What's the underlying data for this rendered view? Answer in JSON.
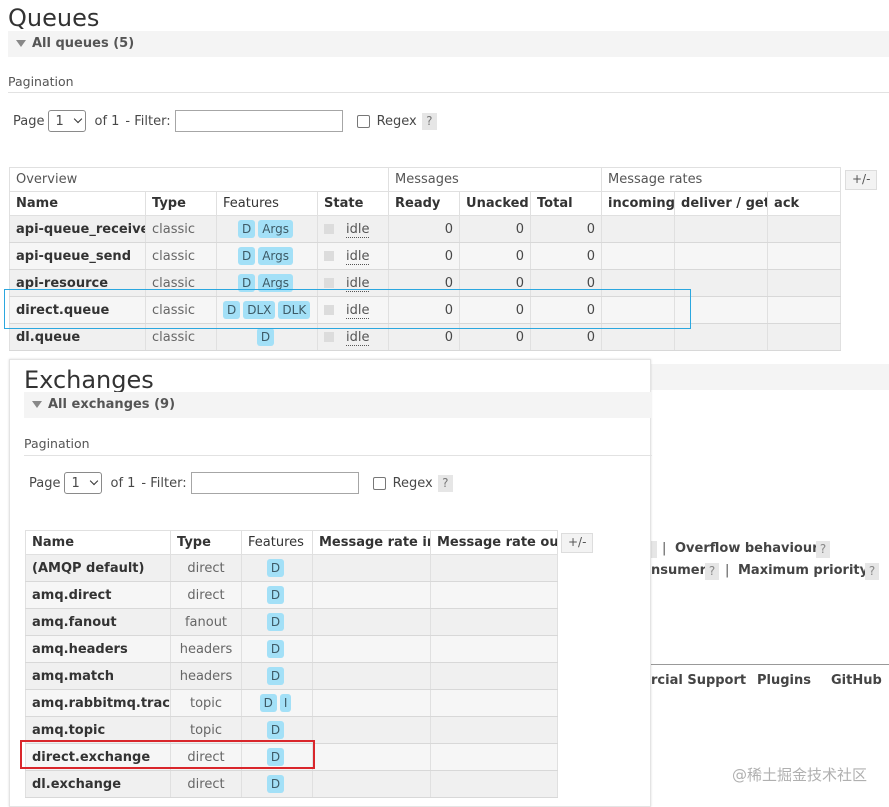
{
  "queues": {
    "title": "Queues",
    "section_label": "All queues (5)",
    "pagination": {
      "label": "Pagination",
      "page_label": "Page",
      "page_value": "1",
      "of_label": "of 1",
      "filter_label": "- Filter:",
      "filter_value": "",
      "regex_label": "Regex",
      "help": "?"
    },
    "group_headers": [
      "Overview",
      "Messages",
      "Message rates"
    ],
    "columns": [
      "Name",
      "Type",
      "Features",
      "State",
      "Ready",
      "Unacked",
      "Total",
      "incoming",
      "deliver / get",
      "ack"
    ],
    "plus_minus": "+/-",
    "rows": [
      {
        "name": "api-queue_receive",
        "type": "classic",
        "features": [
          "D",
          "Args"
        ],
        "state": "idle",
        "ready": "0",
        "unacked": "0",
        "total": "0"
      },
      {
        "name": "api-queue_send",
        "type": "classic",
        "features": [
          "D",
          "Args"
        ],
        "state": "idle",
        "ready": "0",
        "unacked": "0",
        "total": "0"
      },
      {
        "name": "api-resource",
        "type": "classic",
        "features": [
          "D",
          "Args"
        ],
        "state": "idle",
        "ready": "0",
        "unacked": "0",
        "total": "0"
      },
      {
        "name": "direct.queue",
        "type": "classic",
        "features": [
          "D",
          "DLX",
          "DLK"
        ],
        "state": "idle",
        "ready": "0",
        "unacked": "0",
        "total": "0"
      },
      {
        "name": "dl.queue",
        "type": "classic",
        "features": [
          "D"
        ],
        "state": "idle",
        "ready": "0",
        "unacked": "0",
        "total": "0"
      }
    ]
  },
  "exchanges": {
    "title": "Exchanges",
    "section_label": "All exchanges (9)",
    "pagination": {
      "label": "Pagination",
      "page_label": "Page",
      "page_value": "1",
      "of_label": "of 1",
      "filter_label": "- Filter:",
      "filter_value": "",
      "regex_label": "Regex",
      "help": "?"
    },
    "columns": [
      "Name",
      "Type",
      "Features",
      "Message rate in",
      "Message rate out"
    ],
    "plus_minus": "+/-",
    "rows": [
      {
        "name": "(AMQP default)",
        "type": "direct",
        "features": [
          "D"
        ]
      },
      {
        "name": "amq.direct",
        "type": "direct",
        "features": [
          "D"
        ]
      },
      {
        "name": "amq.fanout",
        "type": "fanout",
        "features": [
          "D"
        ]
      },
      {
        "name": "amq.headers",
        "type": "headers",
        "features": [
          "D"
        ]
      },
      {
        "name": "amq.match",
        "type": "headers",
        "features": [
          "D"
        ]
      },
      {
        "name": "amq.rabbitmq.trace",
        "type": "topic",
        "features": [
          "D",
          "I"
        ]
      },
      {
        "name": "amq.topic",
        "type": "topic",
        "features": [
          "D"
        ]
      },
      {
        "name": "direct.exchange",
        "type": "direct",
        "features": [
          "D"
        ]
      },
      {
        "name": "dl.exchange",
        "type": "direct",
        "features": [
          "D"
        ]
      }
    ]
  },
  "background": {
    "overflow_behaviour": "Overflow behaviour",
    "consumer_fragment": "nsumer",
    "maximum_priority": "Maximum priority",
    "help": "?",
    "pipe": "|",
    "footer_links": [
      "rcial Support",
      "Plugins",
      "GitHub"
    ]
  },
  "watermark": "@稀土掘金技术社区",
  "colors": {
    "feature_tag_bg": "#a3e0f7",
    "highlight_blue": "#2ba7df",
    "highlight_red": "#d9262b",
    "row_bg": "#f0f0f0"
  }
}
